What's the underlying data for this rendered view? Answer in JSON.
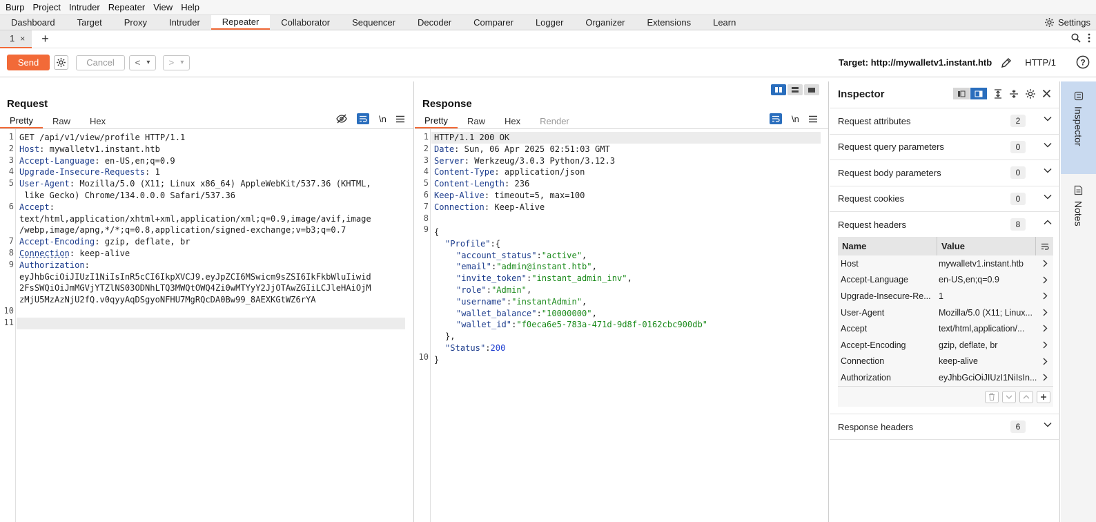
{
  "menu": [
    "Burp",
    "Project",
    "Intruder",
    "Repeater",
    "View",
    "Help"
  ],
  "tabs": [
    "Dashboard",
    "Target",
    "Proxy",
    "Intruder",
    "Repeater",
    "Collaborator",
    "Sequencer",
    "Decoder",
    "Comparer",
    "Logger",
    "Organizer",
    "Extensions",
    "Learn"
  ],
  "active_tab": "Repeater",
  "settings_label": "Settings",
  "subtab": {
    "label": "1",
    "close": "×",
    "add": "+"
  },
  "toolbar": {
    "send": "Send",
    "cancel": "Cancel",
    "back": "<",
    "forward": ">",
    "dropdown": "▾",
    "target_label": "Target: http://mywalletv1.instant.htb",
    "protocol": "HTTP/1",
    "help": "?"
  },
  "request": {
    "title": "Request",
    "tabs": [
      "Pretty",
      "Raw",
      "Hex"
    ],
    "newline_label": "\\n",
    "line_numbers": [
      "1",
      "2",
      "3",
      "4",
      "5",
      "",
      "6",
      "",
      "",
      "7",
      "8",
      "9",
      "",
      "",
      "",
      "10",
      "11"
    ],
    "lines": [
      {
        "k": "",
        "v": "GET /api/v1/view/profile HTTP/1.1"
      },
      {
        "k": "Host",
        "v": ": mywalletv1.instant.htb"
      },
      {
        "k": "Accept-Language",
        "v": ": en-US,en;q=0.9"
      },
      {
        "k": "Upgrade-Insecure-Requests",
        "v": ": 1"
      },
      {
        "k": "User-Agent",
        "v": ": Mozilla/5.0 (X11; Linux x86_64) AppleWebKit/537.36 (KHTML,"
      },
      {
        "k": "",
        "v": " like Gecko) Chrome/134.0.0.0 Safari/537.36"
      },
      {
        "k": "Accept",
        "v": ":"
      },
      {
        "k": "",
        "v": "text/html,application/xhtml+xml,application/xml;q=0.9,image/avif,image"
      },
      {
        "k": "",
        "v": "/webp,image/apng,*/*;q=0.8,application/signed-exchange;v=b3;q=0.7"
      },
      {
        "k": "Accept-Encoding",
        "v": ": gzip, deflate, br"
      },
      {
        "k": "Connection",
        "v": ": keep-alive"
      },
      {
        "k": "Authorization",
        "v": ":"
      },
      {
        "k": "",
        "v": "eyJhbGciOiJIUzI1NiIsInR5cCI6IkpXVCJ9.eyJpZCI6MSwicm9sZSI6IkFkbWluIiwid"
      },
      {
        "k": "",
        "v": "2FsSWQiOiJmMGVjYTZlNS03ODNhLTQ3MWQtOWQ4Zi0wMTYyY2JjOTAwZGIiLCJleHAiOjM"
      },
      {
        "k": "",
        "v": "zMjU5MzAzNjU2fQ.v0qyyAqDSgyoNFHU7MgRQcDA0Bw99_8AEXKGtWZ6rYA"
      },
      {
        "k": "",
        "v": ""
      },
      {
        "k": "",
        "v": ""
      }
    ]
  },
  "response": {
    "title": "Response",
    "tabs": [
      "Pretty",
      "Raw",
      "Hex",
      "Render"
    ],
    "newline_label": "\\n",
    "line_numbers": [
      "1",
      "2",
      "3",
      "4",
      "5",
      "6",
      "7",
      "8",
      "9",
      "",
      "",
      "",
      "",
      "",
      "",
      "",
      "",
      "",
      "",
      "10"
    ],
    "headers": [
      {
        "k": "",
        "v": "HTTP/1.1 200 OK"
      },
      {
        "k": "Date",
        "v": ": Sun, 06 Apr 2025 02:51:03 GMT"
      },
      {
        "k": "Server",
        "v": ": Werkzeug/3.0.3 Python/3.12.3"
      },
      {
        "k": "Content-Type",
        "v": ": application/json"
      },
      {
        "k": "Content-Length",
        "v": ": 236"
      },
      {
        "k": "Keep-Alive",
        "v": ": timeout=5, max=100"
      },
      {
        "k": "Connection",
        "v": ": Keep-Alive"
      }
    ],
    "json_open": "{",
    "profile_key": "\"Profile\"",
    "profile_open": ":{",
    "fields": [
      {
        "k": "\"account_status\"",
        "v": "\"active\"",
        "sep": ","
      },
      {
        "k": "\"email\"",
        "v": "\"admin@instant.htb\"",
        "sep": ","
      },
      {
        "k": "\"invite_token\"",
        "v": "\"instant_admin_inv\"",
        "sep": ","
      },
      {
        "k": "\"role\"",
        "v": "\"Admin\"",
        "sep": ","
      },
      {
        "k": "\"username\"",
        "v": "\"instantAdmin\"",
        "sep": ","
      },
      {
        "k": "\"wallet_balance\"",
        "v": "\"10000000\"",
        "sep": ","
      },
      {
        "k": "\"wallet_id\"",
        "v": "\"f0eca6e5-783a-471d-9d8f-0162cbc900db\"",
        "sep": ""
      }
    ],
    "profile_close": "},",
    "status_key": "\"Status\"",
    "status_value": "200",
    "json_close": "}"
  },
  "inspector": {
    "title": "Inspector",
    "sections": [
      {
        "label": "Request attributes",
        "count": "2"
      },
      {
        "label": "Request query parameters",
        "count": "0"
      },
      {
        "label": "Request body parameters",
        "count": "0"
      },
      {
        "label": "Request cookies",
        "count": "0"
      },
      {
        "label": "Request headers",
        "count": "8"
      }
    ],
    "header_cols": [
      "Name",
      "Value"
    ],
    "header_rows": [
      {
        "name": "Host",
        "value": "mywalletv1.instant.htb"
      },
      {
        "name": "Accept-Language",
        "value": "en-US,en;q=0.9"
      },
      {
        "name": "Upgrade-Insecure-Re...",
        "value": "1"
      },
      {
        "name": "User-Agent",
        "value": "Mozilla/5.0 (X11; Linux..."
      },
      {
        "name": "Accept",
        "value": "text/html,application/..."
      },
      {
        "name": "Accept-Encoding",
        "value": "gzip, deflate, br"
      },
      {
        "name": "Connection",
        "value": "keep-alive"
      },
      {
        "name": "Authorization",
        "value": "eyJhbGciOiJIUzI1NiIsIn..."
      }
    ],
    "response_headers": {
      "label": "Response headers",
      "count": "6"
    }
  },
  "sidebar": [
    "Inspector",
    "Notes"
  ],
  "colors": {
    "accent": "#f26a38",
    "blue": "#2a6ebd"
  }
}
